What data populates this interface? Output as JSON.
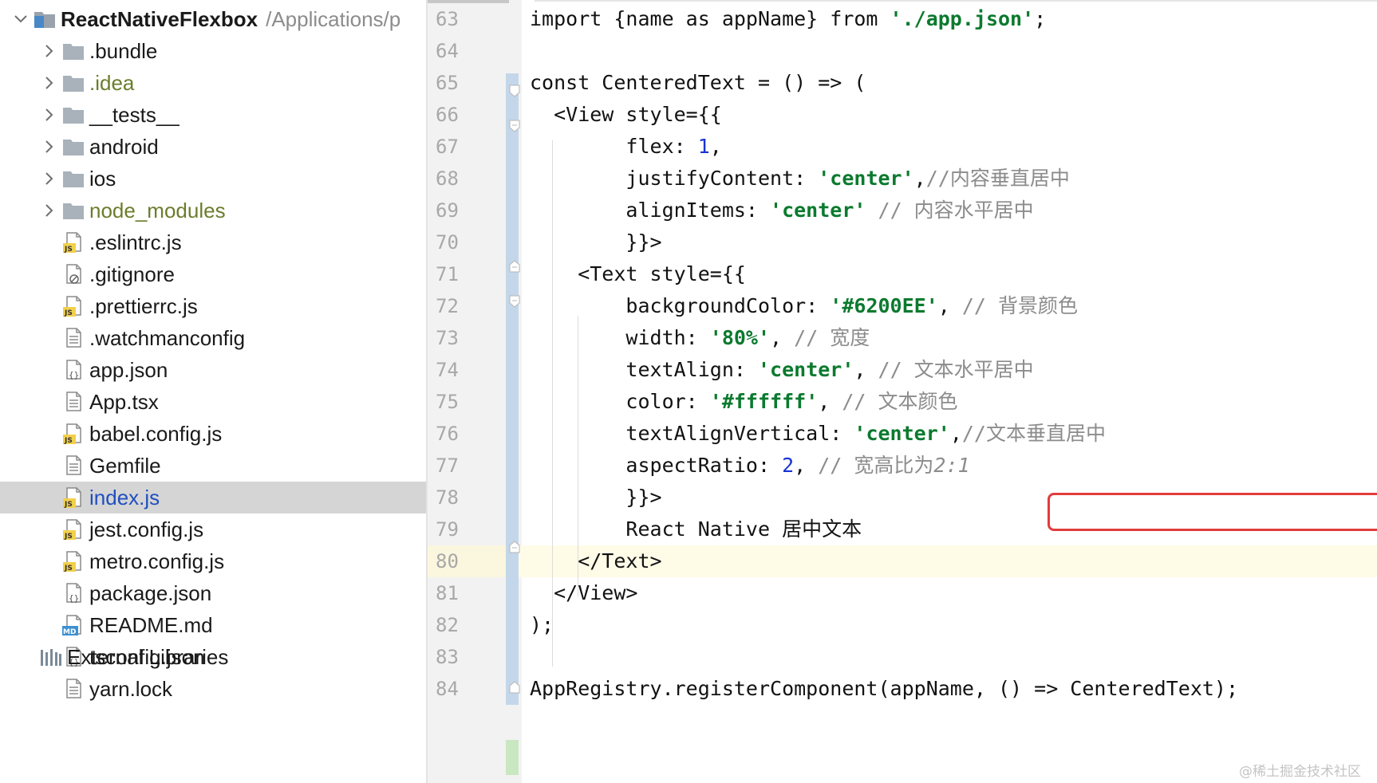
{
  "project": {
    "name": "ReactNativeFlexbox",
    "path": "/Applications/p",
    "items": [
      {
        "label": ".bundle",
        "type": "folder"
      },
      {
        "label": ".idea",
        "type": "folder",
        "ignored": true
      },
      {
        "label": "__tests__",
        "type": "folder"
      },
      {
        "label": "android",
        "type": "folder"
      },
      {
        "label": "ios",
        "type": "folder"
      },
      {
        "label": "node_modules",
        "type": "folder",
        "ignored": true
      },
      {
        "label": ".eslintrc.js",
        "type": "js"
      },
      {
        "label": ".gitignore",
        "type": "ignore"
      },
      {
        "label": ".prettierrc.js",
        "type": "js"
      },
      {
        "label": ".watchmanconfig",
        "type": "text"
      },
      {
        "label": "app.json",
        "type": "json"
      },
      {
        "label": "App.tsx",
        "type": "text"
      },
      {
        "label": "babel.config.js",
        "type": "js"
      },
      {
        "label": "Gemfile",
        "type": "text"
      },
      {
        "label": "index.js",
        "type": "js",
        "selected": true
      },
      {
        "label": "jest.config.js",
        "type": "js"
      },
      {
        "label": "metro.config.js",
        "type": "js"
      },
      {
        "label": "package.json",
        "type": "json"
      },
      {
        "label": "README.md",
        "type": "md"
      },
      {
        "label": "tsconfig.json",
        "type": "json"
      },
      {
        "label": "yarn.lock",
        "type": "text"
      }
    ],
    "external_libraries": "External Libraries"
  },
  "editor": {
    "current_line": 80,
    "lines": [
      {
        "n": "63",
        "tokens": [
          {
            "t": "import {name as appName} from "
          },
          {
            "t": "'./app.json'",
            "c": "str"
          },
          {
            "t": ";"
          }
        ]
      },
      {
        "n": "64",
        "tokens": []
      },
      {
        "n": "65",
        "tokens": [
          {
            "t": "const CenteredText = () => ("
          }
        ]
      },
      {
        "n": "66",
        "tokens": [
          {
            "t": "  <View style={{"
          }
        ]
      },
      {
        "n": "67",
        "tokens": [
          {
            "t": "        flex: "
          },
          {
            "t": "1",
            "c": "num"
          },
          {
            "t": ","
          }
        ]
      },
      {
        "n": "68",
        "tokens": [
          {
            "t": "        justifyContent: "
          },
          {
            "t": "'center'",
            "c": "str"
          },
          {
            "t": ","
          },
          {
            "t": "//内容垂直居中",
            "c": "cmt"
          }
        ]
      },
      {
        "n": "69",
        "tokens": [
          {
            "t": "        alignItems: "
          },
          {
            "t": "'center'",
            "c": "str"
          },
          {
            "t": " "
          },
          {
            "t": "// 内容水平居中",
            "c": "cmt"
          }
        ]
      },
      {
        "n": "70",
        "tokens": [
          {
            "t": "        }}>"
          }
        ]
      },
      {
        "n": "71",
        "tokens": [
          {
            "t": "    <Text style={{"
          }
        ]
      },
      {
        "n": "72",
        "tokens": [
          {
            "t": "        backgroundColor: "
          },
          {
            "t": "'#6200EE'",
            "c": "str"
          },
          {
            "t": ", "
          },
          {
            "t": "// 背景颜色",
            "c": "cmt"
          }
        ]
      },
      {
        "n": "73",
        "tokens": [
          {
            "t": "        width: "
          },
          {
            "t": "'80%'",
            "c": "str"
          },
          {
            "t": ", "
          },
          {
            "t": "// 宽度",
            "c": "cmt"
          }
        ]
      },
      {
        "n": "74",
        "tokens": [
          {
            "t": "        textAlign: "
          },
          {
            "t": "'center'",
            "c": "str"
          },
          {
            "t": ", "
          },
          {
            "t": "// 文本水平居中",
            "c": "cmt"
          }
        ]
      },
      {
        "n": "75",
        "tokens": [
          {
            "t": "        color: "
          },
          {
            "t": "'#ffffff'",
            "c": "str"
          },
          {
            "t": ", "
          },
          {
            "t": "// 文本颜色",
            "c": "cmt"
          }
        ]
      },
      {
        "n": "76",
        "tokens": [
          {
            "t": "        textAlignVertical: "
          },
          {
            "t": "'center'",
            "c": "str"
          },
          {
            "t": ","
          },
          {
            "t": "//文本垂直居中",
            "c": "cmt"
          }
        ]
      },
      {
        "n": "77",
        "tokens": [
          {
            "t": "        aspectRatio: "
          },
          {
            "t": "2",
            "c": "num"
          },
          {
            "t": ", "
          },
          {
            "t": "// 宽高比为",
            "c": "cmt"
          },
          {
            "t": "2:1",
            "c": "cmt-it"
          }
        ]
      },
      {
        "n": "78",
        "tokens": [
          {
            "t": "        }}>"
          }
        ]
      },
      {
        "n": "79",
        "tokens": [
          {
            "t": "        React Native 居中文本"
          }
        ]
      },
      {
        "n": "80",
        "tokens": [
          {
            "t": "    </Text>"
          }
        ]
      },
      {
        "n": "81",
        "tokens": [
          {
            "t": "  </View>"
          }
        ]
      },
      {
        "n": "82",
        "tokens": [
          {
            "t": ");"
          }
        ]
      },
      {
        "n": "83",
        "tokens": []
      },
      {
        "n": "84",
        "tokens": [
          {
            "t": "AppRegistry.registerComponent(appName, () => CenteredText);"
          }
        ]
      }
    ]
  },
  "watermark": "@稀土掘金技术社区",
  "colors": {
    "string": "#0b7a2e",
    "number": "#1733d6",
    "comment": "#8c8c8c",
    "selection_row": "#d5d5d5",
    "current_line": "#fefbe7",
    "highlight_box": "#e23c3c",
    "change_bar": "#c4d7ea"
  }
}
